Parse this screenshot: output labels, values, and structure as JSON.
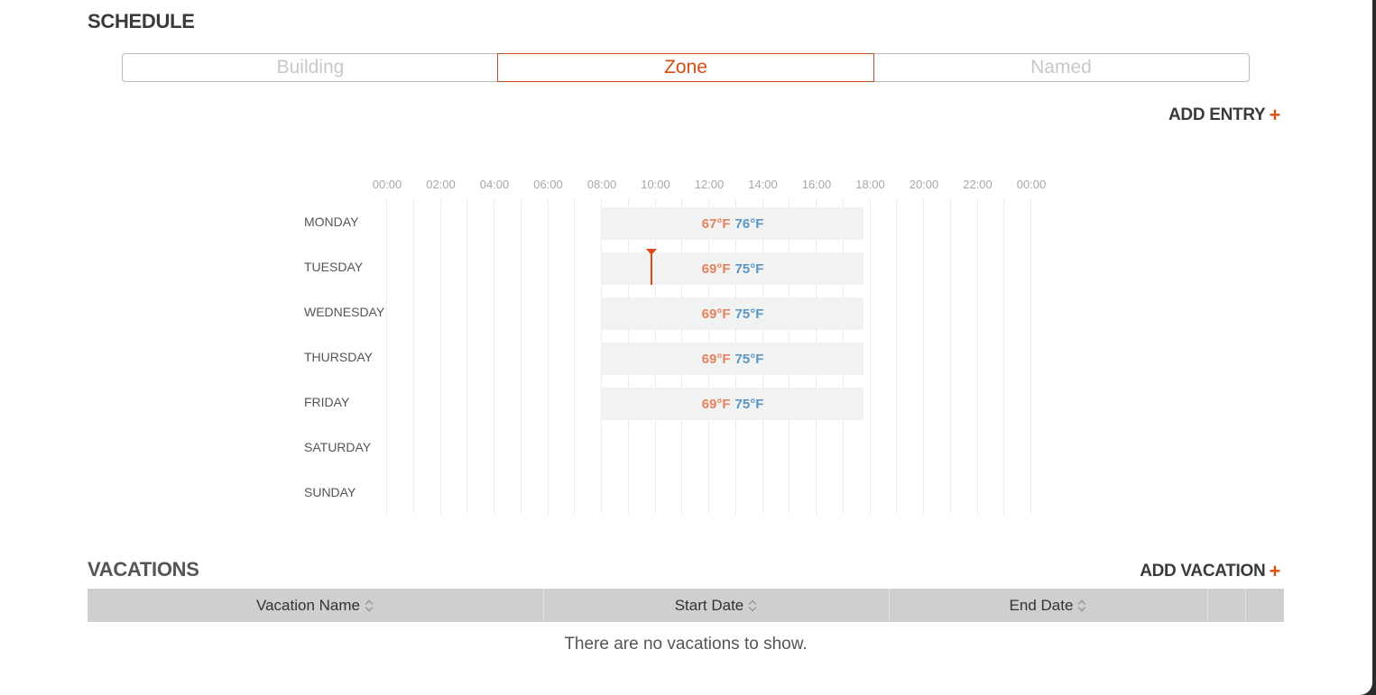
{
  "schedule": {
    "title": "SCHEDULE",
    "tabs": [
      {
        "label": "Building",
        "active": false
      },
      {
        "label": "Zone",
        "active": true
      },
      {
        "label": "Named",
        "active": false
      }
    ],
    "add_entry_label": "ADD ENTRY",
    "add_icon": "plus-icon",
    "hour_labels": [
      "00:00",
      "02:00",
      "04:00",
      "06:00",
      "08:00",
      "10:00",
      "12:00",
      "14:00",
      "16:00",
      "18:00",
      "20:00",
      "22:00",
      "00:00"
    ],
    "days": [
      "MONDAY",
      "TUESDAY",
      "WEDNESDAY",
      "THURSDAY",
      "FRIDAY",
      "SATURDAY",
      "SUNDAY"
    ],
    "entries": [
      {
        "day": "MONDAY",
        "start": "08:00",
        "end": "17:45",
        "heat": "67°F",
        "cool": "76°F"
      },
      {
        "day": "TUESDAY",
        "start": "08:00",
        "end": "17:45",
        "heat": "69°F",
        "cool": "75°F"
      },
      {
        "day": "WEDNESDAY",
        "start": "08:00",
        "end": "17:45",
        "heat": "69°F",
        "cool": "75°F"
      },
      {
        "day": "THURSDAY",
        "start": "08:00",
        "end": "17:45",
        "heat": "69°F",
        "cool": "75°F"
      },
      {
        "day": "FRIDAY",
        "start": "08:00",
        "end": "17:45",
        "heat": "69°F",
        "cool": "75°F"
      }
    ],
    "current_time": {
      "day": "TUESDAY",
      "time": "09:50"
    },
    "colors": {
      "accent": "#d94a14",
      "heat": "#e8825c",
      "cool": "#5b95c2"
    }
  },
  "vacations": {
    "title": "VACATIONS",
    "add_vacation_label": "ADD VACATION",
    "columns": [
      {
        "label": "Vacation Name"
      },
      {
        "label": "Start Date"
      },
      {
        "label": "End Date"
      }
    ],
    "empty_message": "There are no vacations to show."
  }
}
